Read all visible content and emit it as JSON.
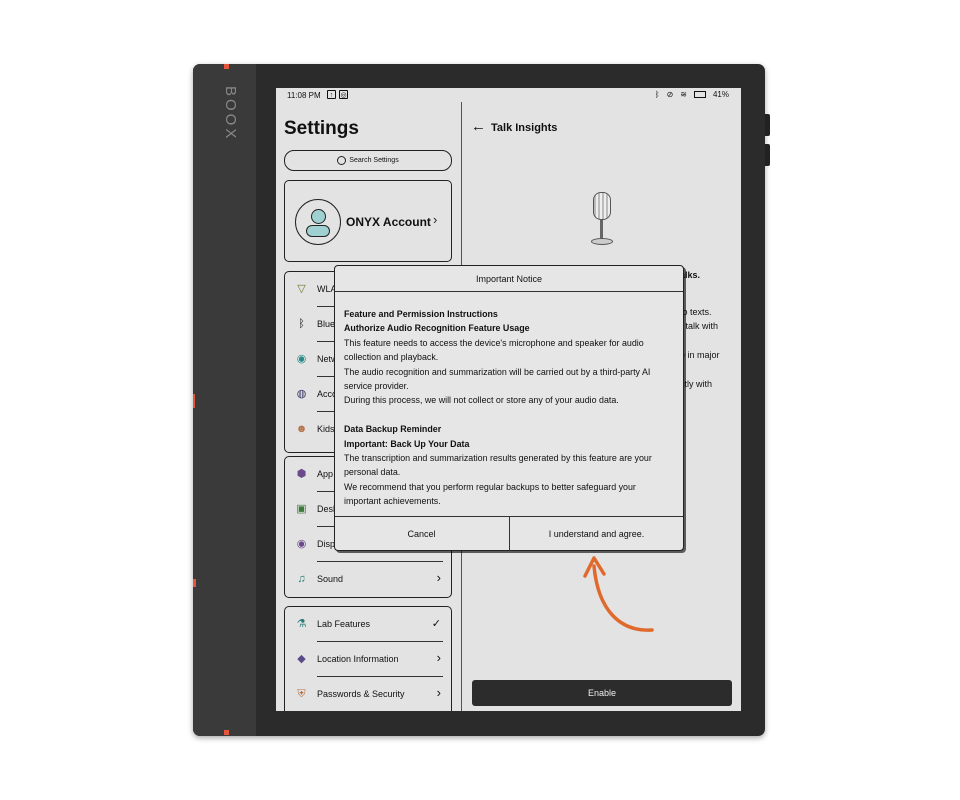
{
  "device": {
    "brand": "BOOX"
  },
  "status_bar": {
    "time": "11:08 PM",
    "battery": "41%"
  },
  "settings": {
    "title": "Settings",
    "search_placeholder": "Search Settings",
    "account": {
      "label": "ONYX Account"
    },
    "group1": [
      {
        "label": "WLA",
        "icon": "wifi-icon"
      },
      {
        "label": "Blue",
        "icon": "bluetooth-icon"
      },
      {
        "label": "Netw",
        "icon": "network-icon"
      },
      {
        "label": "Acco",
        "icon": "accounts-icon"
      },
      {
        "label": "Kids",
        "icon": "kids-icon"
      }
    ],
    "group2": [
      {
        "label": "App",
        "icon": "apps-icon"
      },
      {
        "label": "Desk",
        "icon": "desktop-icon"
      },
      {
        "label": "Disp",
        "icon": "display-icon"
      },
      {
        "label": "Sound",
        "icon": "sound-icon"
      }
    ],
    "group3": [
      {
        "label": "Lab Features",
        "icon": "lab-icon",
        "checked": true
      },
      {
        "label": "Location Information",
        "icon": "location-icon"
      },
      {
        "label": "Passwords & Security",
        "icon": "security-icon"
      }
    ]
  },
  "talk_insights": {
    "title": "Talk Insights",
    "partial_lines": [
      "alks.",
      "to texts.",
      "r talk with",
      "e in major",
      "ctly with"
    ],
    "enable_label": "Enable"
  },
  "modal": {
    "title": "Important Notice",
    "heading1": "Feature and Permission Instructions",
    "heading2": "Authorize Audio Recognition Feature Usage",
    "para1": "This feature needs to access the device's microphone and speaker for audio collection and playback.",
    "para2": "The audio recognition and summarization will be carried out by a third-party AI service provider.",
    "para3": "During this process, we will not collect or store any of your audio data.",
    "heading3": "Data Backup Reminder",
    "heading4": "Important: Back Up Your Data",
    "para4": "The transcription and summarization results generated by this feature are your personal data.",
    "para5": "We recommend that you perform regular backups to better safeguard your important achievements.",
    "cancel_label": "Cancel",
    "agree_label": "I understand and agree."
  },
  "colors": {
    "accent": "#e06a2c",
    "screen": "#e3e3e3",
    "frame": "#2b2b2b"
  }
}
